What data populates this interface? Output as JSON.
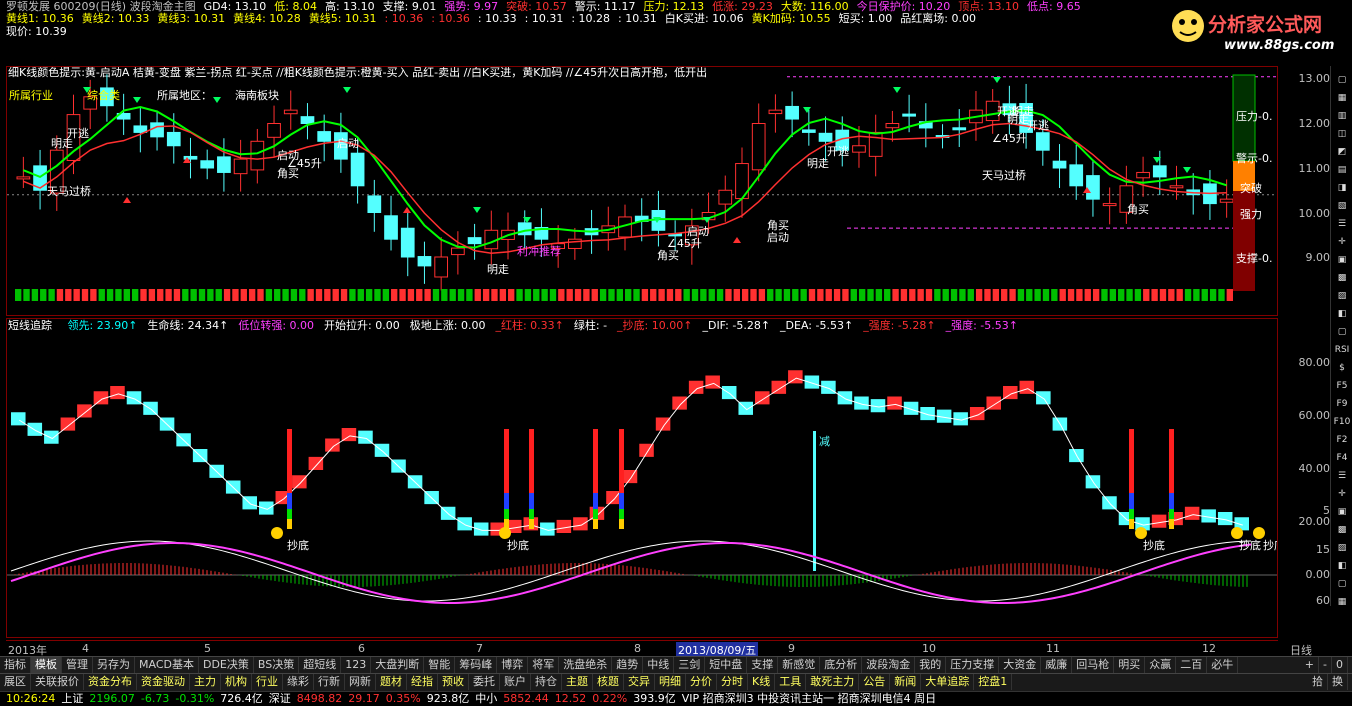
{
  "header": {
    "row1": [
      {
        "text": "罗顿发展 600209(日线) 波段淘金主图",
        "color": "#c0c0c0"
      },
      {
        "text": "GD4: 13.10",
        "color": "#ffffff"
      },
      {
        "text": "低: 8.04",
        "color": "#ffff00"
      },
      {
        "text": "高: 13.10",
        "color": "#ffffff"
      },
      {
        "text": "支撑: 9.01",
        "color": "#ffffff"
      },
      {
        "text": "强势: 9.97",
        "color": "#ff40ff"
      },
      {
        "text": "突破: 10.57",
        "color": "#ff3030"
      },
      {
        "text": "警示: 11.17",
        "color": "#ffffff"
      },
      {
        "text": "压力: 12.13",
        "color": "#ffff00"
      },
      {
        "text": "低涨: 29.23",
        "color": "#ff3030"
      },
      {
        "text": "大数: 116.00",
        "color": "#ffff00"
      },
      {
        "text": "今日保护价: 10.20",
        "color": "#ff40ff"
      },
      {
        "text": "顶点: 13.10",
        "color": "#ff3030"
      },
      {
        "text": "低点: 9.65",
        "color": "#ff40ff"
      }
    ],
    "row2": [
      {
        "text": "黄线1: 10.36",
        "color": "#ffff00"
      },
      {
        "text": "黄线2: 10.33",
        "color": "#ffff00"
      },
      {
        "text": "黄线3: 10.31",
        "color": "#ffff00"
      },
      {
        "text": "黄线4: 10.28",
        "color": "#ffff00"
      },
      {
        "text": "黄线5: 10.31",
        "color": "#ffff00"
      },
      {
        "text": ": 10.36",
        "color": "#ff3030"
      },
      {
        "text": ": 10.36",
        "color": "#ff3030"
      },
      {
        "text": ": 10.33",
        "color": "#ffffff"
      },
      {
        "text": ": 10.31",
        "color": "#ffffff"
      },
      {
        "text": ": 10.28",
        "color": "#ffffff"
      },
      {
        "text": ": 10.31",
        "color": "#ffffff"
      },
      {
        "text": "白K买进: 10.06",
        "color": "#ffffff"
      },
      {
        "text": "黄K加码: 10.55",
        "color": "#ffff00"
      },
      {
        "text": "短买: 1.00",
        "color": "#ffffff"
      },
      {
        "text": "品红离场: 0.00",
        "color": "#ffffff"
      }
    ],
    "row3": [
      {
        "text": "现价: 10.39",
        "color": "#ffffff"
      }
    ]
  },
  "main_chart": {
    "legend_line": "细K线颜色提示:黄-启动A  桔黄-变盘  紫兰-拐点  红-买点   //粗K线颜色提示:橙黄-买入  品红-卖出   //白K买进，黄K加码   //∠45升次日高开抱，低开出",
    "industry_label": "所属行业",
    "industry_value": "综合类",
    "region_label": "所属地区：",
    "region_value": "海南板块",
    "annotations": [
      "开逃",
      "明走",
      "启动",
      "∠45升",
      "角买",
      "天马过桥",
      "启动",
      "明走",
      "开逃",
      "明走",
      "∠45升",
      "角买",
      "启动",
      "利冲推荐",
      "启动",
      "∠45升",
      "角买",
      "明走",
      "开逃",
      "天马过桥",
      "明走",
      "开逃",
      "角买"
    ],
    "right_labels": [
      "压力-0.",
      "警示-0.",
      "突破",
      "强力",
      "支撑-0."
    ],
    "y_ticks": [
      "13.00",
      "12.00",
      "11.00",
      "10.00",
      "9.00"
    ]
  },
  "sub_chart": {
    "title": "短线追踪",
    "indicators": [
      {
        "text": "领先: 23.90↑",
        "color": "#00ffff"
      },
      {
        "text": "生命线: 24.34↑",
        "color": "#ffffff"
      },
      {
        "text": "低位转强: 0.00",
        "color": "#ff40ff"
      },
      {
        "text": "开始拉升: 0.00",
        "color": "#ffffff"
      },
      {
        "text": "极地上涨: 0.00",
        "color": "#ffffff"
      },
      {
        "text": "_红柱: 0.33↑",
        "color": "#ff3030"
      },
      {
        "text": "绿柱: -",
        "color": "#ffffff"
      },
      {
        "text": "_抄底: 10.00↑",
        "color": "#ff3030"
      },
      {
        "text": "_DIF: -5.28↑",
        "color": "#ffffff"
      },
      {
        "text": "_DEA: -5.53↑",
        "color": "#ffffff"
      },
      {
        "text": "_强度: -5.28↑",
        "color": "#ff3030"
      },
      {
        "text": "_强度: -5.53↑",
        "color": "#ff40ff"
      }
    ],
    "annotations": [
      "抄底",
      "抄底",
      "减",
      "抄底",
      "抄底",
      "抄底"
    ],
    "y_ticks": [
      "80.00",
      "60.00",
      "40.00",
      "20.00",
      "0.00"
    ],
    "y_ticks_right": [
      "5",
      "15",
      "30",
      "60"
    ]
  },
  "date_axis": {
    "labels": [
      "2013年",
      "4",
      "5",
      "6",
      "7",
      "8",
      "2013/08/09/五",
      "9",
      "10",
      "11",
      "12"
    ],
    "period": "日线"
  },
  "tabs_row1": [
    "指标",
    "模板",
    "管理",
    "另存为",
    "MACD基本",
    "DDE决策",
    "BS决策",
    "超短线",
    "123",
    "大盘判断",
    "智能",
    "筹码峰",
    "博弈",
    "将军",
    "洗盘绝杀",
    "趋势",
    "中线",
    "三剑",
    "短中盘",
    "支撑",
    "新感觉",
    "底分析",
    "波段淘金",
    "我的",
    "压力支撑",
    "大资金",
    "威廉",
    "回马枪",
    "明买",
    "众赢",
    "二百",
    "必牛"
  ],
  "tabs_row1_active": "模板",
  "tabs_row2": [
    "展区",
    "关联报价",
    "资金分布",
    "资金驱动",
    "主力",
    "机构",
    "行业",
    "缘彩",
    "行新",
    "网新",
    "题材",
    "经指",
    "预收",
    "委托",
    "账户",
    "持仓",
    "主题",
    "核题",
    "交异",
    "明细",
    "分价",
    "分时",
    "K线",
    "工具",
    "敢死主力",
    "公告",
    "新闻",
    "大单追踪",
    "控盘1"
  ],
  "tabs_row2_right": [
    "拾",
    "换"
  ],
  "tabs_row1_right": [
    "+",
    "-",
    "0"
  ],
  "statusbar": [
    {
      "text": "10:26:24",
      "color": "#ffff00"
    },
    {
      "text": "上证",
      "color": "#ffffff"
    },
    {
      "text": "2196.07",
      "color": "#00e000"
    },
    {
      "text": "-6.73",
      "color": "#00e000"
    },
    {
      "text": "-0.31%",
      "color": "#00e000"
    },
    {
      "text": "726.4亿",
      "color": "#ffffff"
    },
    {
      "text": "深证",
      "color": "#ffffff"
    },
    {
      "text": "8498.82",
      "color": "#ff3030"
    },
    {
      "text": "29.17",
      "color": "#ff3030"
    },
    {
      "text": "0.35%",
      "color": "#ff3030"
    },
    {
      "text": "923.8亿",
      "color": "#ffffff"
    },
    {
      "text": "中小",
      "color": "#ffffff"
    },
    {
      "text": "5852.44",
      "color": "#ff3030"
    },
    {
      "text": "12.52",
      "color": "#ff3030"
    },
    {
      "text": "0.22%",
      "color": "#ff3030"
    },
    {
      "text": "393.9亿",
      "color": "#ffffff"
    },
    {
      "text": "VIP 招商深圳3  中投资讯主站一  招商深圳电信4  周日",
      "color": "#ffffff"
    }
  ],
  "logo": {
    "title": "分析家公式网",
    "url": "www.88gs.com"
  },
  "right_toolbar": [
    "RSI",
    "$",
    "F5",
    "F9",
    "F10",
    "F2",
    "F4"
  ],
  "colors": {
    "up": "#ff3030",
    "down": "#54ffff",
    "ma": "#00ff00",
    "grid": "#800000",
    "bg": "#000000"
  }
}
